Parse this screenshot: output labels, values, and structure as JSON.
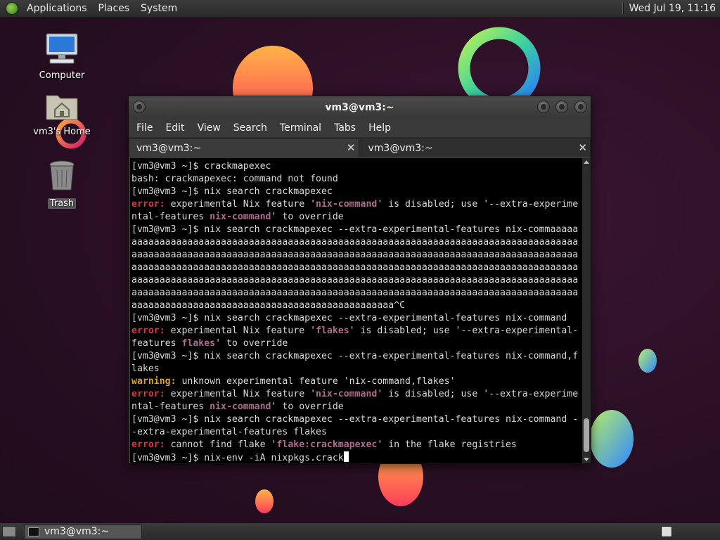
{
  "top_panel": {
    "menus": [
      "Applications",
      "Places",
      "System"
    ],
    "clock": "Wed Jul 19, 11:16"
  },
  "desktop": {
    "icons": [
      {
        "label": "Computer",
        "icon": "computer-icon"
      },
      {
        "label": "vm3's Home",
        "icon": "home-folder-icon"
      },
      {
        "label": "Trash",
        "icon": "trash-icon"
      }
    ]
  },
  "window": {
    "title": "vm3@vm3:~",
    "menu": [
      "File",
      "Edit",
      "View",
      "Search",
      "Terminal",
      "Tabs",
      "Help"
    ],
    "tabs": [
      {
        "label": "vm3@vm3:~",
        "active": true
      },
      {
        "label": "vm3@vm3:~",
        "active": false
      }
    ],
    "close_glyph": "✕"
  },
  "terminal": {
    "lines": [
      [
        {
          "t": "[vm3@vm3 ~]$ crackmapexec"
        }
      ],
      [
        {
          "t": "bash: crackmapexec: command not found"
        }
      ],
      [
        {
          "t": "[vm3@vm3 ~]$ nix search crackmapexec"
        }
      ],
      [
        {
          "t": "error:",
          "c": "err"
        },
        {
          "t": " experimental Nix feature '"
        },
        {
          "t": "nix-command",
          "c": "hl"
        },
        {
          "t": "' is disabled; use '--extra-experime"
        }
      ],
      [
        {
          "t": "ntal-features "
        },
        {
          "t": "nix-command",
          "c": "hl"
        },
        {
          "t": "' to override"
        }
      ],
      [
        {
          "t": "[vm3@vm3 ~]$ nix search crackmapexec --extra-experimental-features nix-commaaaaa"
        }
      ],
      [
        {
          "t": "aaaaaaaaaaaaaaaaaaaaaaaaaaaaaaaaaaaaaaaaaaaaaaaaaaaaaaaaaaaaaaaaaaaaaaaaaaaaaaaa"
        }
      ],
      [
        {
          "t": "aaaaaaaaaaaaaaaaaaaaaaaaaaaaaaaaaaaaaaaaaaaaaaaaaaaaaaaaaaaaaaaaaaaaaaaaaaaaaaaa"
        }
      ],
      [
        {
          "t": "aaaaaaaaaaaaaaaaaaaaaaaaaaaaaaaaaaaaaaaaaaaaaaaaaaaaaaaaaaaaaaaaaaaaaaaaaaaaaaaa"
        }
      ],
      [
        {
          "t": "aaaaaaaaaaaaaaaaaaaaaaaaaaaaaaaaaaaaaaaaaaaaaaaaaaaaaaaaaaaaaaaaaaaaaaaaaaaaaaaa"
        }
      ],
      [
        {
          "t": "aaaaaaaaaaaaaaaaaaaaaaaaaaaaaaaaaaaaaaaaaaaaaaaaaaaaaaaaaaaaaaaaaaaaaaaaaaaaaaaa"
        }
      ],
      [
        {
          "t": "aaaaaaaaaaaaaaaaaaaaaaaaaaaaaaaaaaaaaaaaaaaaaaa^C"
        }
      ],
      [
        {
          "t": "[vm3@vm3 ~]$ nix search crackmapexec --extra-experimental-features nix-command"
        }
      ],
      [
        {
          "t": "error:",
          "c": "err"
        },
        {
          "t": " experimental Nix feature '"
        },
        {
          "t": "flakes",
          "c": "hl"
        },
        {
          "t": "' is disabled; use '--extra-experimental-"
        }
      ],
      [
        {
          "t": "features "
        },
        {
          "t": "flakes",
          "c": "hl"
        },
        {
          "t": "' to override"
        }
      ],
      [
        {
          "t": "[vm3@vm3 ~]$ nix search crackmapexec --extra-experimental-features nix-command,f"
        }
      ],
      [
        {
          "t": "lakes"
        }
      ],
      [
        {
          "t": "warning:",
          "c": "warn"
        },
        {
          "t": " unknown experimental feature 'nix-command,flakes'"
        }
      ],
      [
        {
          "t": "error:",
          "c": "err"
        },
        {
          "t": " experimental Nix feature '"
        },
        {
          "t": "nix-command",
          "c": "hl"
        },
        {
          "t": "' is disabled; use '--extra-experime"
        }
      ],
      [
        {
          "t": "ntal-features "
        },
        {
          "t": "nix-command",
          "c": "hl"
        },
        {
          "t": "' to override"
        }
      ],
      [
        {
          "t": "[vm3@vm3 ~]$ nix search crackmapexec --extra-experimental-features nix-command -"
        }
      ],
      [
        {
          "t": "-extra-experimental-features flakes"
        }
      ],
      [
        {
          "t": "error:",
          "c": "err"
        },
        {
          "t": " cannot find flake '"
        },
        {
          "t": "flake:crackmapexec",
          "c": "hl"
        },
        {
          "t": "' in the flake registries"
        }
      ],
      [
        {
          "t": "[vm3@vm3 ~]$ nix-env -iA nixpkgs.crack"
        }
      ]
    ]
  },
  "taskbar": {
    "task_label": "vm3@vm3:~"
  }
}
